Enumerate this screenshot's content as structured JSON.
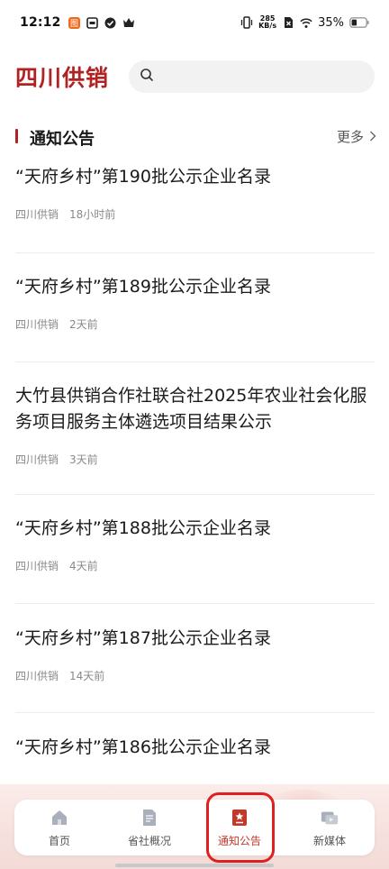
{
  "status_bar": {
    "time": "12:12",
    "net_speed_value": "285",
    "net_speed_unit": "KB/s",
    "battery": "35%"
  },
  "header": {
    "brand": "四川供销",
    "search_placeholder": ""
  },
  "section": {
    "title": "通知公告",
    "more": "更多"
  },
  "news": [
    {
      "title": "“天府乡村”第190批公示企业名录",
      "source": "四川供销",
      "time": "18小时前"
    },
    {
      "title": "“天府乡村”第189批公示企业名录",
      "source": "四川供销",
      "time": "2天前"
    },
    {
      "title": "大竹县供销合作社联合社2025年农业社会化服务项目服务主体遴选项目结果公示",
      "source": "四川供销",
      "time": "3天前"
    },
    {
      "title": "“天府乡村”第188批公示企业名录",
      "source": "四川供销",
      "time": "4天前"
    },
    {
      "title": "“天府乡村”第187批公示企业名录",
      "source": "四川供销",
      "time": "14天前"
    },
    {
      "title": "“天府乡村”第186批公示企业名录",
      "source": "",
      "time": ""
    }
  ],
  "bottom_nav": {
    "items": [
      {
        "label": "首页",
        "icon": "home-icon"
      },
      {
        "label": "省社概况",
        "icon": "document-icon"
      },
      {
        "label": "通知公告",
        "icon": "notice-icon",
        "active": true
      },
      {
        "label": "新媒体",
        "icon": "media-icon"
      }
    ],
    "active_color": "#c0392b"
  },
  "colors": {
    "brand": "#b22222",
    "highlight_ring": "#e02020"
  }
}
